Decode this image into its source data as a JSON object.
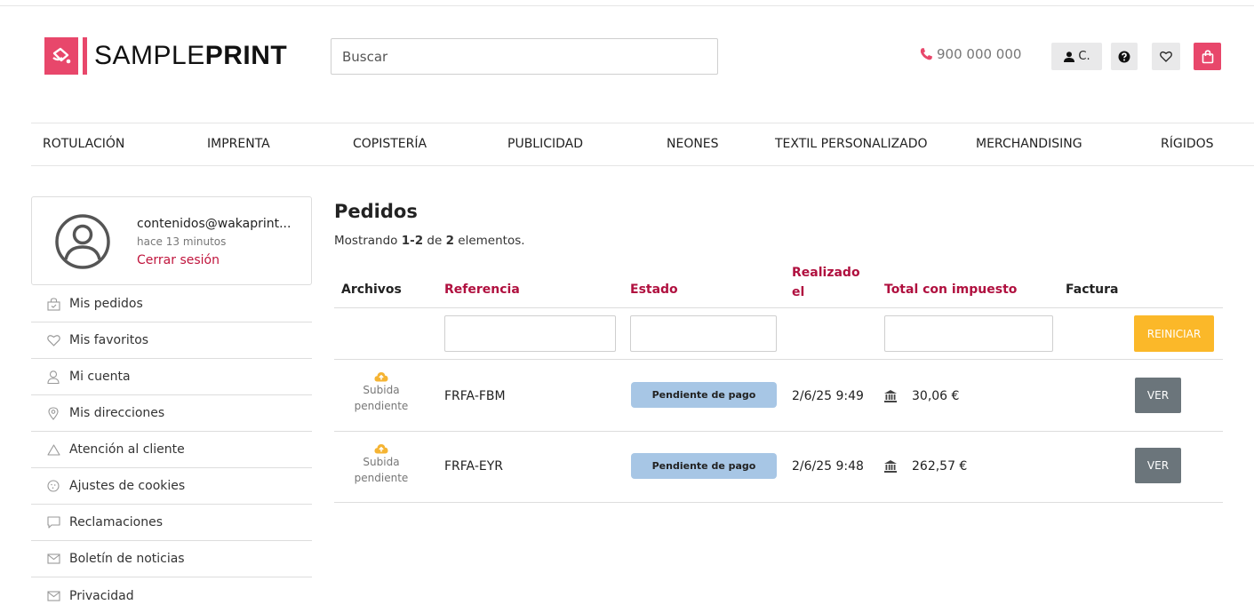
{
  "header": {
    "logo_text_light": "SAMPLE",
    "logo_text_bold": "PRINT",
    "search_placeholder": "Buscar",
    "phone": "900 000 000",
    "user_label": "C.",
    "brand_color": "#e8476b"
  },
  "nav": [
    "ROTULACIÓN",
    "IMPRENTA",
    "COPISTERÍA",
    "PUBLICIDAD",
    "NEONES",
    "TEXTIL PERSONALIZADO",
    "MERCHANDISING",
    "RÍGIDOS"
  ],
  "profile": {
    "email": "contenidos@wakaprint...",
    "last_seen": "hace 13 minutos",
    "logout": "Cerrar sesión"
  },
  "sidebar": [
    {
      "label": "Mis pedidos",
      "icon": "orders-icon"
    },
    {
      "label": "Mis favoritos",
      "icon": "heart-icon"
    },
    {
      "label": "Mi cuenta",
      "icon": "user-icon"
    },
    {
      "label": "Mis direcciones",
      "icon": "location-pin-icon"
    },
    {
      "label": "Atención al cliente",
      "icon": "warning-triangle-icon"
    },
    {
      "label": "Ajustes de cookies",
      "icon": "cookie-icon"
    },
    {
      "label": "Reclamaciones",
      "icon": "chat-icon"
    },
    {
      "label": "Boletín de noticias",
      "icon": "mail-icon"
    },
    {
      "label": "Privacidad",
      "icon": "mail-icon"
    }
  ],
  "main": {
    "title": "Pedidos",
    "summary_prefix": "Mostrando ",
    "summary_range": "1-2",
    "summary_mid": " de ",
    "summary_total": "2",
    "summary_suffix": " elementos.",
    "columns": {
      "archivos": "Archivos",
      "referencia": "Referencia",
      "estado": "Estado",
      "realizado_1": "Realizado",
      "realizado_2": "el",
      "total": "Total con impuesto",
      "factura": "Factura"
    },
    "reset_label": "REINICIAR",
    "rows": [
      {
        "upload_1": "Subida",
        "upload_2": "pendiente",
        "ref": "FRFA-FBM",
        "status": "Pendiente de pago",
        "date": "2/6/25 9:49",
        "total": "30,06 €",
        "action": "VER"
      },
      {
        "upload_1": "Subida",
        "upload_2": "pendiente",
        "ref": "FRFA-EYR",
        "status": "Pendiente de pago",
        "date": "2/6/25 9:48",
        "total": "262,57 €",
        "action": "VER"
      }
    ]
  }
}
